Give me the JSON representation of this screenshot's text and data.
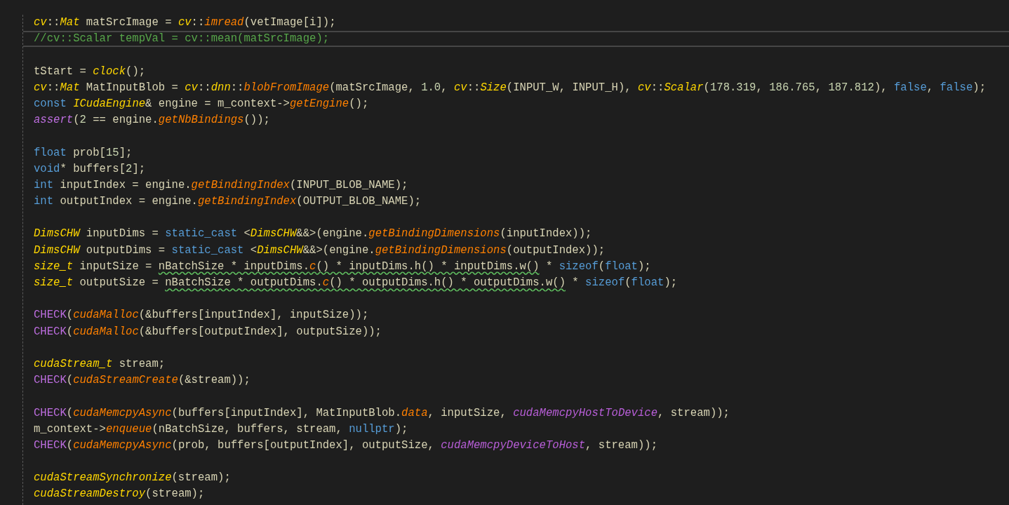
{
  "lines": [
    {
      "selected": false,
      "tokens": [
        {
          "kind": "type",
          "text": "cv"
        },
        {
          "kind": "plain",
          "text": "::"
        },
        {
          "kind": "type",
          "text": "Mat"
        },
        {
          "kind": "plain",
          "text": " matSrcImage = "
        },
        {
          "kind": "type",
          "text": "cv"
        },
        {
          "kind": "plain",
          "text": "::"
        },
        {
          "kind": "fn",
          "text": "imread"
        },
        {
          "kind": "plain",
          "text": "(vetImage[i]);"
        }
      ]
    },
    {
      "selected": true,
      "tokens": [
        {
          "kind": "comment",
          "text": "//cv::Scalar tempVal = cv::mean(matSrcImage);"
        }
      ]
    },
    {
      "selected": false
    },
    {
      "selected": false,
      "tokens": [
        {
          "kind": "plain",
          "text": "tStart = "
        },
        {
          "kind": "type",
          "text": "clock"
        },
        {
          "kind": "plain",
          "text": "();"
        }
      ]
    },
    {
      "selected": false,
      "tokens": [
        {
          "kind": "type",
          "text": "cv"
        },
        {
          "kind": "plain",
          "text": "::"
        },
        {
          "kind": "type",
          "text": "Mat"
        },
        {
          "kind": "plain",
          "text": " MatInputBlob = "
        },
        {
          "kind": "type",
          "text": "cv"
        },
        {
          "kind": "plain",
          "text": "::"
        },
        {
          "kind": "type",
          "text": "dnn"
        },
        {
          "kind": "plain",
          "text": "::"
        },
        {
          "kind": "fn",
          "text": "blobFromImage"
        },
        {
          "kind": "plain",
          "text": "(matSrcImage, "
        },
        {
          "kind": "num",
          "text": "1.0"
        },
        {
          "kind": "plain",
          "text": ", "
        },
        {
          "kind": "type",
          "text": "cv"
        },
        {
          "kind": "plain",
          "text": "::"
        },
        {
          "kind": "type",
          "text": "Size"
        },
        {
          "kind": "plain",
          "text": "(INPUT_W, INPUT_H), "
        },
        {
          "kind": "type",
          "text": "cv"
        },
        {
          "kind": "plain",
          "text": "::"
        },
        {
          "kind": "type",
          "text": "Scalar"
        },
        {
          "kind": "plain",
          "text": "("
        },
        {
          "kind": "num",
          "text": "178.319"
        },
        {
          "kind": "plain",
          "text": ", "
        },
        {
          "kind": "num",
          "text": "186.765"
        },
        {
          "kind": "plain",
          "text": ", "
        },
        {
          "kind": "num",
          "text": "187.812"
        },
        {
          "kind": "plain",
          "text": "), "
        },
        {
          "kind": "kw",
          "text": "false"
        },
        {
          "kind": "plain",
          "text": ", "
        },
        {
          "kind": "kw",
          "text": "false"
        },
        {
          "kind": "plain",
          "text": ");"
        }
      ]
    },
    {
      "selected": false,
      "tokens": [
        {
          "kind": "kw",
          "text": "const "
        },
        {
          "kind": "type",
          "text": "ICudaEngine"
        },
        {
          "kind": "plain",
          "text": "& engine = m_context->"
        },
        {
          "kind": "fn",
          "text": "getEngine"
        },
        {
          "kind": "plain",
          "text": "();"
        }
      ]
    },
    {
      "selected": false,
      "tokens": [
        {
          "kind": "mfn",
          "text": "assert"
        },
        {
          "kind": "plain",
          "text": "("
        },
        {
          "kind": "num",
          "text": "2"
        },
        {
          "kind": "plain",
          "text": " == engine."
        },
        {
          "kind": "fn",
          "text": "getNbBindings"
        },
        {
          "kind": "plain",
          "text": "());"
        }
      ]
    },
    {
      "selected": false
    },
    {
      "selected": false,
      "tokens": [
        {
          "kind": "kw",
          "text": "float"
        },
        {
          "kind": "plain",
          "text": " prob["
        },
        {
          "kind": "num",
          "text": "15"
        },
        {
          "kind": "plain",
          "text": "];"
        }
      ]
    },
    {
      "selected": false,
      "tokens": [
        {
          "kind": "kw",
          "text": "void"
        },
        {
          "kind": "plain",
          "text": "* buffers["
        },
        {
          "kind": "num",
          "text": "2"
        },
        {
          "kind": "plain",
          "text": "];"
        }
      ]
    },
    {
      "selected": false,
      "tokens": [
        {
          "kind": "kw",
          "text": "int"
        },
        {
          "kind": "plain",
          "text": " inputIndex = engine."
        },
        {
          "kind": "fn",
          "text": "getBindingIndex"
        },
        {
          "kind": "plain",
          "text": "(INPUT_BLOB_NAME);"
        }
      ]
    },
    {
      "selected": false,
      "tokens": [
        {
          "kind": "kw",
          "text": "int"
        },
        {
          "kind": "plain",
          "text": " outputIndex = engine."
        },
        {
          "kind": "fn",
          "text": "getBindingIndex"
        },
        {
          "kind": "plain",
          "text": "(OUTPUT_BLOB_NAME);"
        }
      ]
    },
    {
      "selected": false
    },
    {
      "selected": false,
      "tokens": [
        {
          "kind": "type",
          "text": "DimsCHW"
        },
        {
          "kind": "plain",
          "text": " inputDims = "
        },
        {
          "kind": "kw",
          "text": "static_cast"
        },
        {
          "kind": "plain",
          "text": " <"
        },
        {
          "kind": "type",
          "text": "DimsCHW"
        },
        {
          "kind": "plain",
          "text": "&&>(engine."
        },
        {
          "kind": "fn",
          "text": "getBindingDimensions"
        },
        {
          "kind": "plain",
          "text": "(inputIndex));"
        }
      ]
    },
    {
      "selected": false,
      "tokens": [
        {
          "kind": "type",
          "text": "DimsCHW"
        },
        {
          "kind": "plain",
          "text": " outputDims = "
        },
        {
          "kind": "kw",
          "text": "static_cast"
        },
        {
          "kind": "plain",
          "text": " <"
        },
        {
          "kind": "type",
          "text": "DimsCHW"
        },
        {
          "kind": "plain",
          "text": "&&>(engine."
        },
        {
          "kind": "fn",
          "text": "getBindingDimensions"
        },
        {
          "kind": "plain",
          "text": "(outputIndex));"
        }
      ]
    },
    {
      "selected": false,
      "tokens": [
        {
          "kind": "type",
          "text": "size_t"
        },
        {
          "kind": "plain",
          "text": " inputSize = "
        },
        {
          "kind": "plain",
          "text": "nBatchSize * inputDims.",
          "squiggle": true
        },
        {
          "kind": "fn",
          "text": "c",
          "squiggle": true
        },
        {
          "kind": "plain",
          "text": "() * inputDims.h() * inputDims.w()",
          "squiggle": true
        },
        {
          "kind": "plain",
          "text": " * "
        },
        {
          "kind": "kw",
          "text": "sizeof"
        },
        {
          "kind": "plain",
          "text": "("
        },
        {
          "kind": "kw",
          "text": "float"
        },
        {
          "kind": "plain",
          "text": ");"
        }
      ]
    },
    {
      "selected": false,
      "tokens": [
        {
          "kind": "type",
          "text": "size_t"
        },
        {
          "kind": "plain",
          "text": " outputSize = "
        },
        {
          "kind": "plain",
          "text": "nBatchSize * outputDims.",
          "squiggle": true
        },
        {
          "kind": "fn",
          "text": "c",
          "squiggle": true
        },
        {
          "kind": "plain",
          "text": "() * outputDims.h() * outputDims.w()",
          "squiggle": true
        },
        {
          "kind": "plain",
          "text": " * "
        },
        {
          "kind": "kw",
          "text": "sizeof"
        },
        {
          "kind": "plain",
          "text": "("
        },
        {
          "kind": "kw",
          "text": "float"
        },
        {
          "kind": "plain",
          "text": ");"
        }
      ]
    },
    {
      "selected": false
    },
    {
      "selected": false,
      "tokens": [
        {
          "kind": "macro",
          "text": "CHECK"
        },
        {
          "kind": "plain",
          "text": "("
        },
        {
          "kind": "fn",
          "text": "cudaMalloc"
        },
        {
          "kind": "plain",
          "text": "(&buffers[inputIndex], inputSize));"
        }
      ]
    },
    {
      "selected": false,
      "tokens": [
        {
          "kind": "macro",
          "text": "CHECK"
        },
        {
          "kind": "plain",
          "text": "("
        },
        {
          "kind": "fn",
          "text": "cudaMalloc"
        },
        {
          "kind": "plain",
          "text": "(&buffers[outputIndex], outputSize));"
        }
      ]
    },
    {
      "selected": false
    },
    {
      "selected": false,
      "tokens": [
        {
          "kind": "type",
          "text": "cudaStream_t"
        },
        {
          "kind": "plain",
          "text": " stream;"
        }
      ]
    },
    {
      "selected": false,
      "tokens": [
        {
          "kind": "macro",
          "text": "CHECK"
        },
        {
          "kind": "plain",
          "text": "("
        },
        {
          "kind": "fn",
          "text": "cudaStreamCreate"
        },
        {
          "kind": "plain",
          "text": "(&stream));"
        }
      ]
    },
    {
      "selected": false
    },
    {
      "selected": false,
      "tokens": [
        {
          "kind": "macro",
          "text": "CHECK"
        },
        {
          "kind": "plain",
          "text": "("
        },
        {
          "kind": "fn",
          "text": "cudaMemcpyAsync"
        },
        {
          "kind": "plain",
          "text": "(buffers[inputIndex], MatInputBlob."
        },
        {
          "kind": "fn",
          "text": "data"
        },
        {
          "kind": "plain",
          "text": ", inputSize, "
        },
        {
          "kind": "enum",
          "text": "cudaMemcpyHostToDevice"
        },
        {
          "kind": "plain",
          "text": ", stream));"
        }
      ]
    },
    {
      "selected": false,
      "tokens": [
        {
          "kind": "plain",
          "text": "m_context->"
        },
        {
          "kind": "fn",
          "text": "enqueue"
        },
        {
          "kind": "plain",
          "text": "(nBatchSize, buffers, stream, "
        },
        {
          "kind": "kw",
          "text": "nullptr"
        },
        {
          "kind": "plain",
          "text": ");"
        }
      ]
    },
    {
      "selected": false,
      "tokens": [
        {
          "kind": "macro",
          "text": "CHECK"
        },
        {
          "kind": "plain",
          "text": "("
        },
        {
          "kind": "fn",
          "text": "cudaMemcpyAsync"
        },
        {
          "kind": "plain",
          "text": "(prob, buffers[outputIndex], outputSize, "
        },
        {
          "kind": "enum",
          "text": "cudaMemcpyDeviceToHost"
        },
        {
          "kind": "plain",
          "text": ", stream));"
        }
      ]
    },
    {
      "selected": false
    },
    {
      "selected": false,
      "tokens": [
        {
          "kind": "type",
          "text": "cudaStreamSynchronize"
        },
        {
          "kind": "plain",
          "text": "(stream);"
        }
      ]
    },
    {
      "selected": false,
      "tokens": [
        {
          "kind": "type",
          "text": "cudaStreamDestroy"
        },
        {
          "kind": "plain",
          "text": "(stream);"
        }
      ]
    }
  ]
}
